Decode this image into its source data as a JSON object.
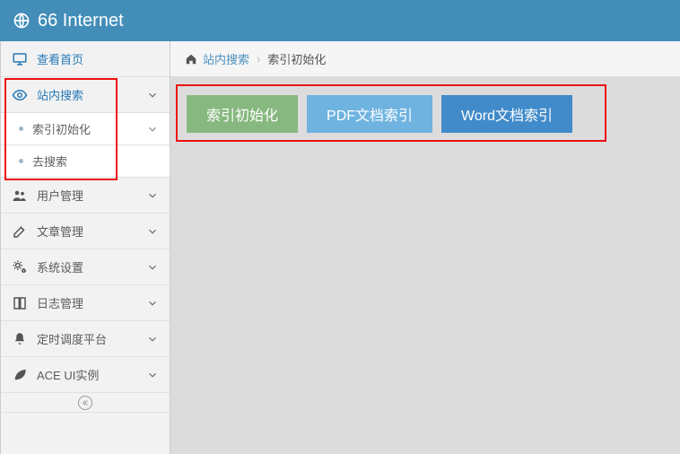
{
  "topbar": {
    "title": "66 Internet"
  },
  "sidebar": {
    "items": [
      {
        "label": "查看首页",
        "icon": "monitor",
        "expandable": false
      },
      {
        "label": "站内搜索",
        "icon": "eye",
        "expandable": true,
        "active": true,
        "children": [
          {
            "label": "索引初始化",
            "expandable": true
          },
          {
            "label": "去搜索",
            "expandable": false
          }
        ]
      },
      {
        "label": "用户管理",
        "icon": "users",
        "expandable": true
      },
      {
        "label": "文章管理",
        "icon": "edit",
        "expandable": true
      },
      {
        "label": "系统设置",
        "icon": "gears",
        "expandable": true
      },
      {
        "label": "日志管理",
        "icon": "book",
        "expandable": true
      },
      {
        "label": "定时调度平台",
        "icon": "bell",
        "expandable": true
      },
      {
        "label": "ACE UI实例",
        "icon": "leaf",
        "expandable": true
      }
    ]
  },
  "breadcrumb": {
    "root": "站内搜索",
    "current": "索引初始化"
  },
  "buttons": {
    "init_index": "索引初始化",
    "pdf_index": "PDF文档索引",
    "word_index": "Word文档索引"
  }
}
